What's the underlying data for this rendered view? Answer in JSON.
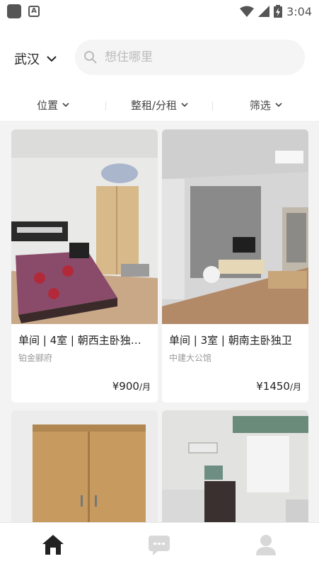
{
  "status_bar": {
    "time": "3:04"
  },
  "header": {
    "city": "武汉"
  },
  "search": {
    "placeholder": "想住哪里"
  },
  "filters": [
    {
      "label": "位置"
    },
    {
      "label": "整租/分租"
    },
    {
      "label": "筛选"
    }
  ],
  "listings": [
    {
      "title": "单间 | 4室 | 朝西主卧独卫...",
      "community": "铂金郦府",
      "price": "¥900",
      "unit": "/月"
    },
    {
      "title": "单间 | 3室 | 朝南主卧独卫",
      "community": "中建大公馆",
      "price": "¥1450",
      "unit": "/月"
    }
  ],
  "nav": {
    "items": [
      {
        "icon": "home-icon",
        "active": true
      },
      {
        "icon": "message-icon",
        "active": false
      },
      {
        "icon": "profile-icon",
        "active": false
      }
    ]
  },
  "colors": {
    "accent": "#222222",
    "inactive_icon": "#d8d8d8",
    "muted_text": "#999999"
  }
}
